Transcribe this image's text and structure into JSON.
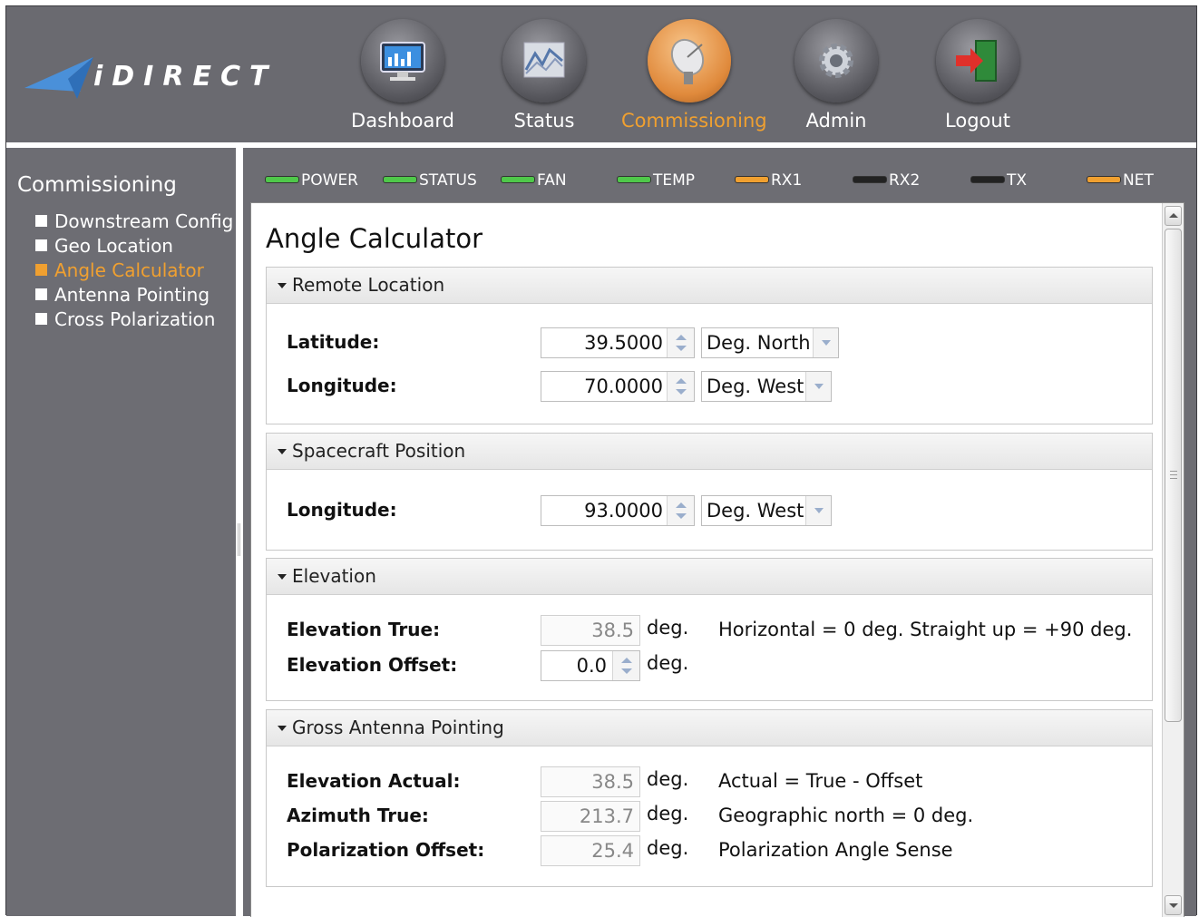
{
  "brand": {
    "logo_text": "iDIRECT"
  },
  "nav": {
    "items": [
      {
        "label": "Dashboard",
        "icon": "monitor-icon"
      },
      {
        "label": "Status",
        "icon": "graph-icon"
      },
      {
        "label": "Commissioning",
        "icon": "satellite-dish-icon",
        "active": true
      },
      {
        "label": "Admin",
        "icon": "gear-icon"
      },
      {
        "label": "Logout",
        "icon": "exit-door-icon"
      }
    ]
  },
  "sidebar": {
    "title": "Commissioning",
    "items": [
      {
        "label": "Downstream Config"
      },
      {
        "label": "Geo Location"
      },
      {
        "label": "Angle Calculator",
        "active": true
      },
      {
        "label": "Antenna Pointing"
      },
      {
        "label": "Cross Polarization"
      }
    ]
  },
  "leds": [
    {
      "label": "POWER",
      "color": "#4fc84a"
    },
    {
      "label": "STATUS",
      "color": "#4fc84a"
    },
    {
      "label": "FAN",
      "color": "#4fc84a"
    },
    {
      "label": "TEMP",
      "color": "#4fc84a"
    },
    {
      "label": "RX1",
      "color": "#f0a030"
    },
    {
      "label": "RX2",
      "color": "#222222"
    },
    {
      "label": "TX",
      "color": "#222222"
    },
    {
      "label": "NET",
      "color": "#f0a030"
    }
  ],
  "page": {
    "title": "Angle Calculator"
  },
  "remote_location": {
    "header": "Remote Location",
    "latitude_label": "Latitude:",
    "latitude_value": "39.5000",
    "latitude_dir": "Deg. North",
    "longitude_label": "Longitude:",
    "longitude_value": "70.0000",
    "longitude_dir": "Deg. West"
  },
  "spacecraft": {
    "header": "Spacecraft Position",
    "longitude_label": "Longitude:",
    "longitude_value": "93.0000",
    "longitude_dir": "Deg. West"
  },
  "elevation": {
    "header": "Elevation",
    "true_label": "Elevation True:",
    "true_value": "38.5",
    "true_unit": "deg.",
    "true_note": "Horizontal = 0 deg. Straight up = +90 deg.",
    "offset_label": "Elevation Offset:",
    "offset_value": "0.0",
    "offset_unit": "deg."
  },
  "cross_pointing": {
    "header": "Gross Antenna Pointing",
    "elev_actual_label": "Elevation Actual:",
    "elev_actual_value": "38.5",
    "elev_actual_unit": "deg.",
    "elev_actual_note": "Actual = True - Offset",
    "azimuth_label": "Azimuth True:",
    "azimuth_value": "213.7",
    "azimuth_unit": "deg.",
    "azimuth_note": "Geographic north = 0 deg.",
    "polar_label": "Polarization Offset:",
    "polar_value": "25.4",
    "polar_unit": "deg.",
    "polar_note": "Polarization Angle Sense"
  }
}
